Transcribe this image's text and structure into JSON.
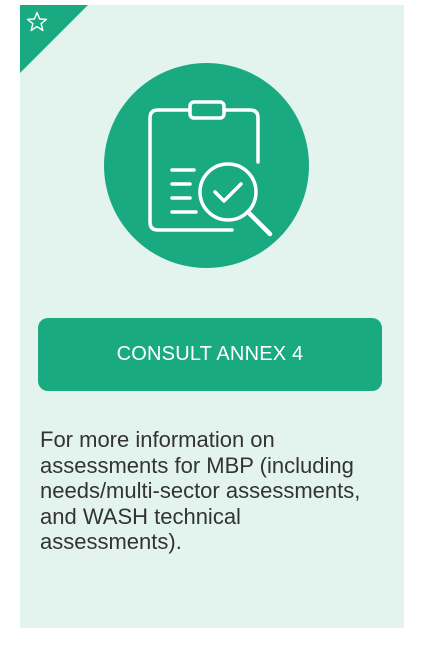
{
  "card": {
    "cta_label": "CONSULT ANNEX 4",
    "description": "For more information on assessments for MBP (including needs/multi-sector assessments, and WASH technical assessments)."
  },
  "icons": {
    "corner": "star-outline-icon",
    "main": "clipboard-magnifier-check-icon"
  },
  "colors": {
    "accent": "#1aaa82",
    "background": "#e3f4ef",
    "text": "#333333"
  }
}
